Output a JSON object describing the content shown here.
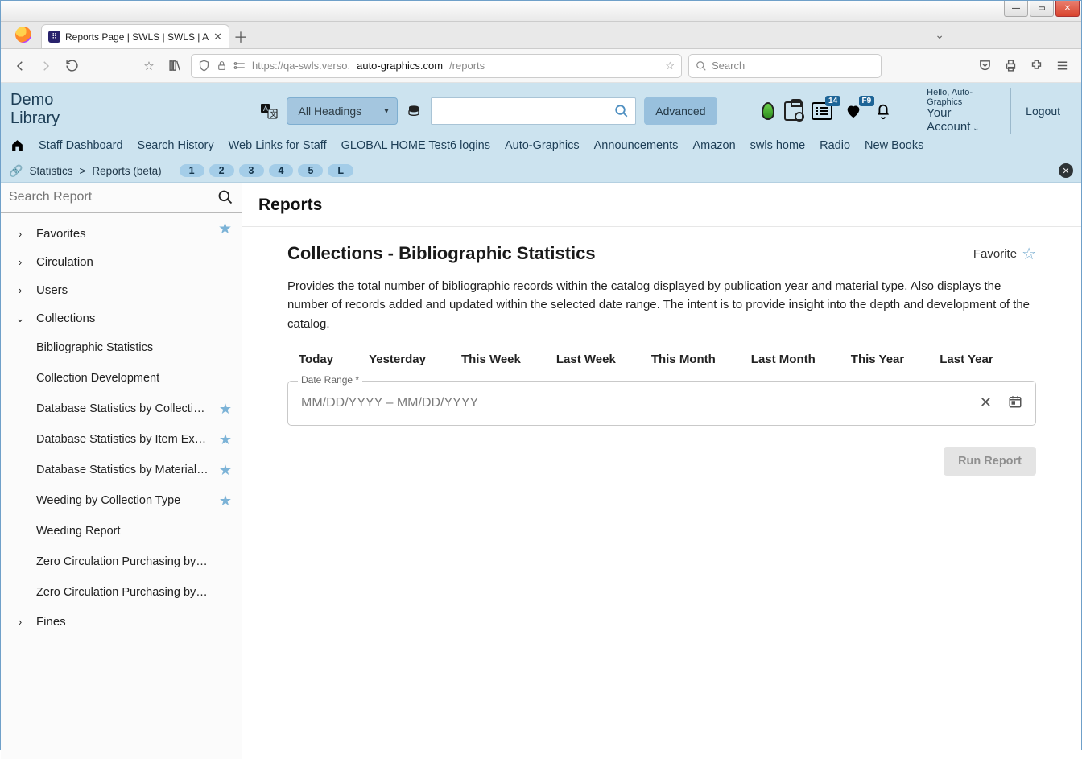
{
  "browser": {
    "tab_title": "Reports Page | SWLS | SWLS | A",
    "url_prefix": "https://qa-swls.verso.",
    "url_host": "auto-graphics.com",
    "url_path": "/reports",
    "search_placeholder": "Search"
  },
  "header": {
    "library_name": "Demo Library",
    "headings_label": "All Headings",
    "advanced_label": "Advanced",
    "badge_lists": "14",
    "badge_fav": "F9",
    "greeting": "Hello, Auto-Graphics",
    "account_label": "Your Account",
    "logout": "Logout"
  },
  "nav": {
    "items": [
      "Staff Dashboard",
      "Search History",
      "Web Links for Staff",
      "GLOBAL HOME Test6 logins",
      "Auto-Graphics",
      "Announcements",
      "Amazon",
      "swls home",
      "Radio",
      "New Books"
    ]
  },
  "crumb": {
    "a": "Statistics",
    "b": "Reports (beta)",
    "chips": [
      "1",
      "2",
      "3",
      "4",
      "5",
      "L"
    ]
  },
  "sidebar": {
    "search_placeholder": "Search Report",
    "groups": {
      "favorites": "Favorites",
      "circulation": "Circulation",
      "users": "Users",
      "collections": "Collections",
      "fines": "Fines"
    },
    "collections_items": [
      {
        "label": "Bibliographic Statistics",
        "starred": false
      },
      {
        "label": "Collection Development",
        "starred": false
      },
      {
        "label": "Database Statistics by Collection …",
        "starred": true
      },
      {
        "label": "Database Statistics by Item Except…",
        "starred": true
      },
      {
        "label": "Database Statistics by Material Ty…",
        "starred": true
      },
      {
        "label": "Weeding by Collection Type",
        "starred": true
      },
      {
        "label": "Weeding Report",
        "starred": false
      },
      {
        "label": "Zero Circulation Purchasing by Collect…",
        "starred": false
      },
      {
        "label": "Zero Circulation Purchasing by Materi…",
        "starred": false
      }
    ]
  },
  "main": {
    "page_title": "Reports",
    "report_title": "Collections - Bibliographic Statistics",
    "favorite_label": "Favorite",
    "description": "Provides the total number of bibliographic records within the catalog displayed by publication year and material type. Also displays the number of records added and updated within the selected date range. The intent is to provide insight into the depth and development of the catalog.",
    "quick_ranges": [
      "Today",
      "Yesterday",
      "This Week",
      "Last Week",
      "This Month",
      "Last Month",
      "This Year",
      "Last Year"
    ],
    "date_legend": "Date Range *",
    "date_placeholder": "MM/DD/YYYY – MM/DD/YYYY",
    "run_label": "Run Report"
  }
}
